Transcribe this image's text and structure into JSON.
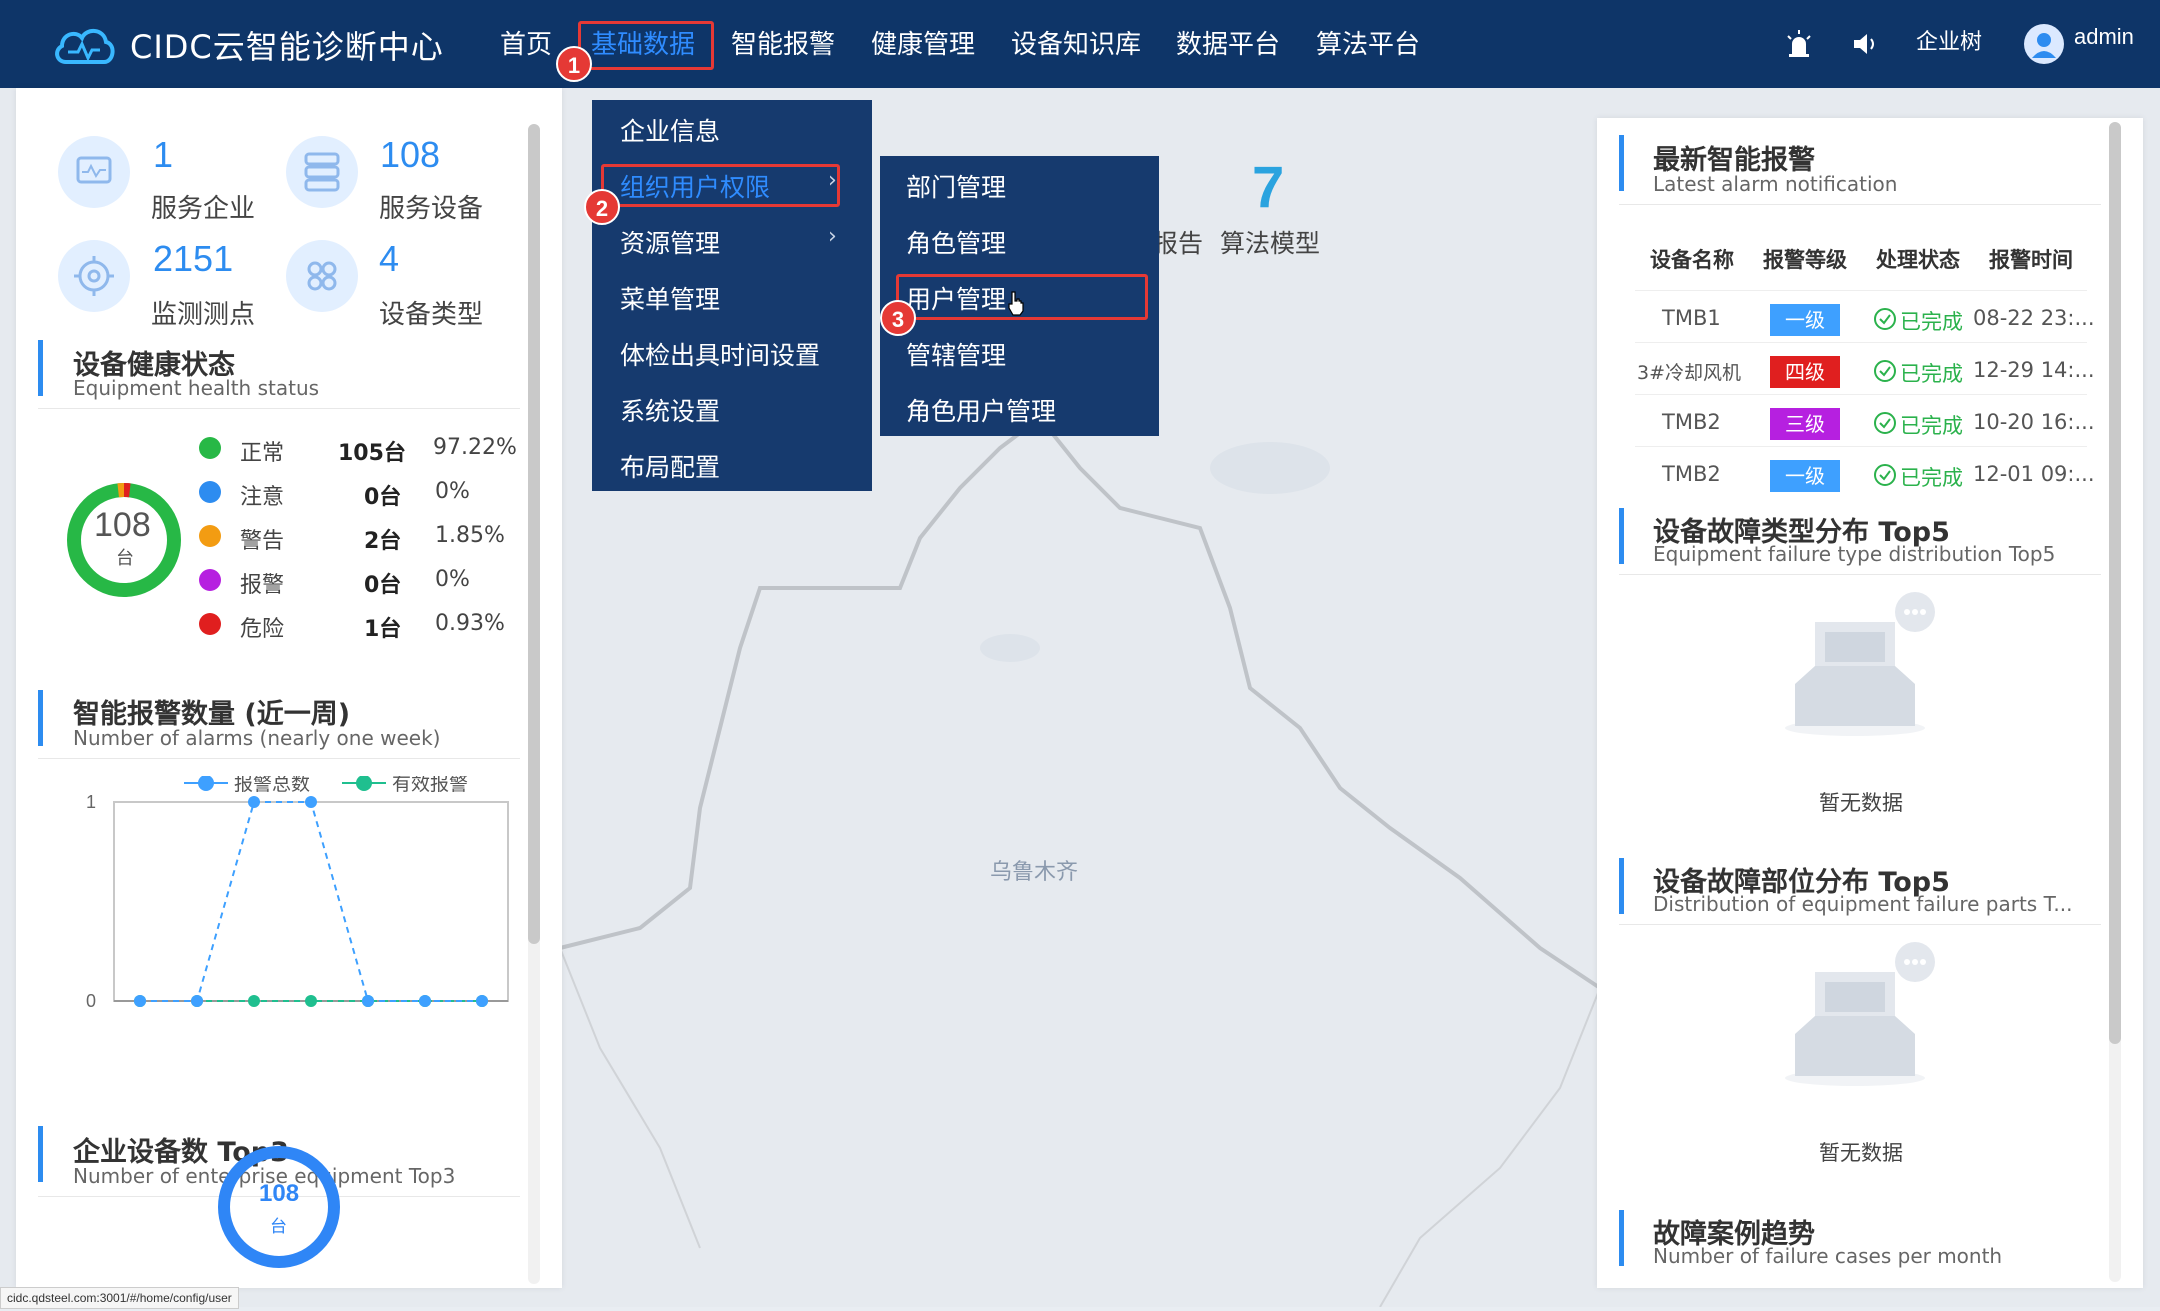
{
  "app": {
    "title": "CIDC云智能诊断中心"
  },
  "nav": {
    "items": [
      {
        "label": "首页"
      },
      {
        "label": "基础数据"
      },
      {
        "label": "智能报警"
      },
      {
        "label": "健康管理"
      },
      {
        "label": "设备知识库"
      },
      {
        "label": "数据平台"
      },
      {
        "label": "算法平台"
      }
    ],
    "active_index": 1,
    "enterprise_tree": "企业树",
    "user": "admin"
  },
  "steps": [
    "1",
    "2",
    "3"
  ],
  "colors": {
    "topbar": "#0e3568",
    "accent": "#2d8cf0",
    "highlight": "#e53935",
    "menu": "#163a6e"
  },
  "stats": [
    {
      "value": "1",
      "label": "服务企业",
      "icon": "monitor-icon"
    },
    {
      "value": "108",
      "label": "服务设备",
      "icon": "server-icon"
    },
    {
      "value": "2151",
      "label": "监测测点",
      "icon": "target-icon"
    },
    {
      "value": "4",
      "label": "设备类型",
      "icon": "grid-icon"
    }
  ],
  "health": {
    "title": "设备健康状态",
    "subtitle": "Equipment health status",
    "total": "108",
    "unit": "台",
    "rows": [
      {
        "label": "正常",
        "count": "105台",
        "pct": "97.22%",
        "color": "#27b846"
      },
      {
        "label": "注意",
        "count": "0台",
        "pct": "0%",
        "color": "#2d8cf0"
      },
      {
        "label": "警告",
        "count": "2台",
        "pct": "1.85%",
        "color": "#f39c12"
      },
      {
        "label": "报警",
        "count": "0台",
        "pct": "0%",
        "color": "#b620e0"
      },
      {
        "label": "危险",
        "count": "1台",
        "pct": "0.93%",
        "color": "#e01f1f"
      }
    ]
  },
  "alarm_chart": {
    "title": "智能报警数量 (近一周)",
    "subtitle": "Number of alarms (nearly one week)",
    "legend": [
      "报警总数",
      "有效报警"
    ]
  },
  "chart_data": {
    "type": "line",
    "x": [
      1,
      2,
      3,
      4,
      5,
      6,
      7
    ],
    "ylim": [
      0,
      1
    ],
    "yticks": [
      "1",
      "0"
    ],
    "series": [
      {
        "name": "报警总数",
        "values": [
          0,
          0,
          1,
          1,
          0,
          0,
          0
        ],
        "color": "#3ea0ff"
      },
      {
        "name": "有效报警",
        "values": [
          0,
          0,
          0,
          0,
          0,
          0,
          0
        ],
        "color": "#1fbf8f"
      }
    ]
  },
  "top3": {
    "title": "企业设备数 Top3",
    "subtitle": "Number of enterprise equipment Top3",
    "total": "108",
    "unit": "台"
  },
  "map": {
    "city": "乌鲁木齐",
    "count_value": "7",
    "count_label": "算法模型",
    "partial_label": "报告"
  },
  "menus": {
    "level1": [
      "企业信息",
      "组织用户权限",
      "资源管理",
      "菜单管理",
      "体检出具时间设置",
      "系统设置",
      "布局配置"
    ],
    "level2": [
      "部门管理",
      "角色管理",
      "用户管理",
      "管辖管理",
      "角色用户管理"
    ]
  },
  "alarms": {
    "title": "最新智能报警",
    "subtitle": "Latest alarm notification",
    "headers": [
      "设备名称",
      "报警等级",
      "处理状态",
      "报警时间"
    ],
    "rows": [
      {
        "name": "TMB1",
        "level": "一级",
        "level_color": "#3ea0ff",
        "status": "已完成",
        "time": "08-22 23:..."
      },
      {
        "name": "3#冷却风机",
        "level": "四级",
        "level_color": "#e01f1f",
        "status": "已完成",
        "time": "12-29 14:..."
      },
      {
        "name": "TMB2",
        "level": "三级",
        "level_color": "#b620e0",
        "status": "已完成",
        "time": "10-20 16:..."
      },
      {
        "name": "TMB2",
        "level": "一级",
        "level_color": "#3ea0ff",
        "status": "已完成",
        "time": "12-01 09:..."
      }
    ]
  },
  "fault_type": {
    "title": "设备故障类型分布 Top5",
    "subtitle": "Equipment failure type distribution Top5",
    "empty": "暂无数据"
  },
  "fault_part": {
    "title": "设备故障部位分布 Top5",
    "subtitle": "Distribution of equipment failure parts T...",
    "empty": "暂无数据"
  },
  "fault_trend": {
    "title": "故障案例趋势",
    "subtitle": "Number of failure cases per month"
  },
  "status_url": "cidc.qdsteel.com:3001/#/home/config/user"
}
